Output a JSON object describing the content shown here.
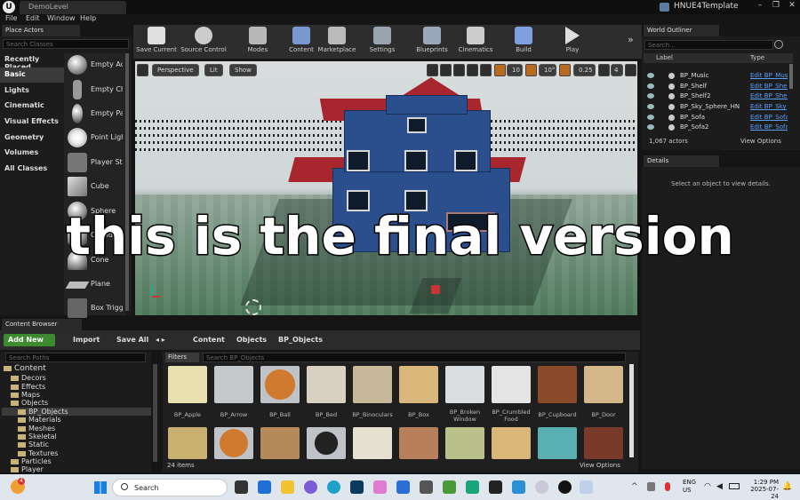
{
  "title_bar": {
    "doc_tab": "DemoLevel",
    "project": "HNUE4Template",
    "min": "–",
    "restore": "❐",
    "close": "✕"
  },
  "menu": [
    "File",
    "Edit",
    "Window",
    "Help"
  ],
  "place_actors": {
    "tab": "Place Actors",
    "search_placeholder": "Search Classes",
    "categories": [
      "Recently Placed",
      "Basic",
      "Lights",
      "Cinematic",
      "Visual Effects",
      "Geometry",
      "Volumes",
      "All Classes"
    ],
    "items": [
      "Empty Actor",
      "Empty Character",
      "Empty Pawn",
      "Point Light",
      "Player Start",
      "Cube",
      "Sphere",
      "Cylinder",
      "Cone",
      "Plane",
      "Box Trigger"
    ]
  },
  "toolbar": [
    "Save Current",
    "Source Control",
    "Modes",
    "Content",
    "Marketplace",
    "Settings",
    "Blueprints",
    "Cinematics",
    "Build",
    "Play"
  ],
  "viewport": {
    "perspective": "Perspective",
    "lit": "Lit",
    "show": "Show",
    "grid": "10",
    "rot": "10°",
    "scale": "0.25",
    "cam": "4"
  },
  "world_outliner": {
    "tab": "World Outliner",
    "search_placeholder": "Search...",
    "col_label": "Label",
    "col_type": "Type",
    "rows": [
      {
        "name": "BP_Music",
        "type": "Edit BP_Music"
      },
      {
        "name": "BP_Shelf",
        "type": "Edit BP_Shelf"
      },
      {
        "name": "BP_Shelf2",
        "type": "Edit BP_Shelf"
      },
      {
        "name": "BP_Sky_Sphere_HN",
        "type": "Edit BP_Sky"
      },
      {
        "name": "BP_Sofa",
        "type": "Edit BP_Sofa"
      },
      {
        "name": "BP_Sofa2",
        "type": "Edit BP_Sofa"
      }
    ],
    "count": "1,067 actors",
    "view_options": "View Options"
  },
  "details": {
    "tab": "Details",
    "message": "Select an object to view details."
  },
  "content_browser": {
    "tab": "Content Browser",
    "add_new": "Add New",
    "import": "Import",
    "save_all": "Save All",
    "path": [
      "Content",
      "Objects",
      "BP_Objects"
    ],
    "search_paths": "Search Paths",
    "filters": "Filters",
    "search_assets": "Search BP_Objects",
    "tree": [
      "Content",
      "Decors",
      "Effects",
      "Maps",
      "Objects",
      "BP_Objects",
      "Materials",
      "Meshes",
      "Skeletal",
      "Static",
      "Textures",
      "Particles",
      "Player"
    ],
    "assets": [
      "BP_Apple",
      "BP_Arrow",
      "BP_Ball",
      "BP_Bed",
      "BP_Binoculars",
      "BP_Box",
      "BP_Broken Window",
      "BP_Crumbled Food",
      "BP_Cupboard",
      "BP_Door"
    ],
    "item_count": "24 items",
    "view_options": "View Options"
  },
  "caption": "this is the final version",
  "taskbar": {
    "search": "Search",
    "lang1": "ENG",
    "lang2": "US",
    "time": "1:29 PM",
    "date": "2025-07-24",
    "badge": "4"
  }
}
